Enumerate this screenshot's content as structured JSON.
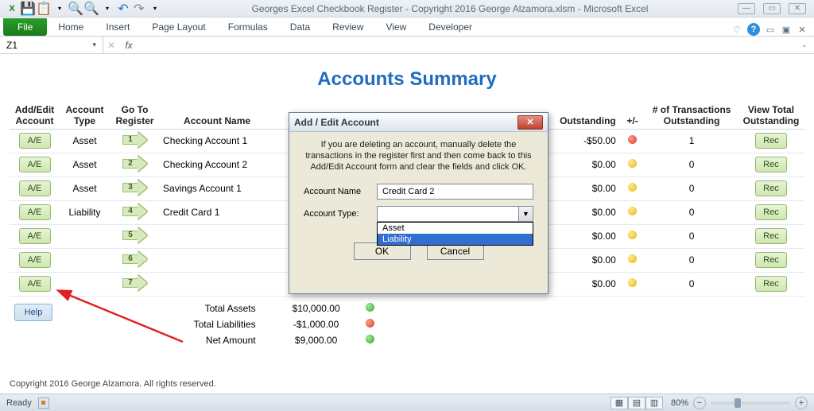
{
  "window": {
    "title": "Georges Excel Checkbook Register - Copyright 2016 George Alzamora.xlsm  -  Microsoft Excel"
  },
  "ribbon": {
    "file": "File",
    "tabs": [
      "Home",
      "Insert",
      "Page Layout",
      "Formulas",
      "Data",
      "Review",
      "View",
      "Developer"
    ]
  },
  "formulabar": {
    "name": "Z1",
    "fx": ""
  },
  "sheet": {
    "title": "Accounts Summary",
    "headers": {
      "ae": "Add/Edit Account",
      "type": "Account Type",
      "goto": "Go To Register",
      "name": "Account Name",
      "outstanding": "Outstanding",
      "plusminus": "+/-",
      "ntrans": "# of Transactions Outstanding",
      "viewtotal": "View Total Outstanding"
    },
    "ae_label": "A/E",
    "rec_label": "Rec",
    "help_label": "Help",
    "rows": [
      {
        "type": "Asset",
        "num": "1",
        "name": "Checking Account 1",
        "outstanding": "-$50.00",
        "dot": "red",
        "ntrans": "1"
      },
      {
        "type": "Asset",
        "num": "2",
        "name": "Checking Account 2",
        "outstanding": "$0.00",
        "dot": "yellow",
        "ntrans": "0"
      },
      {
        "type": "Asset",
        "num": "3",
        "name": "Savings Account 1",
        "outstanding": "$0.00",
        "dot": "yellow",
        "ntrans": "0"
      },
      {
        "type": "Liability",
        "num": "4",
        "name": "Credit Card 1",
        "outstanding": "$0.00",
        "dot": "yellow",
        "ntrans": "0"
      },
      {
        "type": "",
        "num": "5",
        "name": "",
        "outstanding": "$0.00",
        "dot": "yellow",
        "ntrans": "0"
      },
      {
        "type": "",
        "num": "6",
        "name": "",
        "outstanding": "$0.00",
        "dot": "yellow",
        "ntrans": "0"
      },
      {
        "type": "",
        "num": "7",
        "name": "",
        "outstanding": "$0.00",
        "dot": "yellow",
        "ntrans": "0"
      }
    ],
    "totals": [
      {
        "label": "Total Assets",
        "value": "$10,000.00",
        "dot": "green"
      },
      {
        "label": "Total Liabilities",
        "value": "-$1,000.00",
        "dot": "red"
      },
      {
        "label": "Net Amount",
        "value": "$9,000.00",
        "dot": "green"
      }
    ]
  },
  "dialog": {
    "title": "Add / Edit Account",
    "msg": "If you are deleting an account, manually delete the transactions in the register first and then come back to this Add/Edit Account form and clear the fields and click OK.",
    "name_label": "Account Name",
    "name_value": "Credit Card 2",
    "type_label": "Account Type:",
    "options": [
      "Asset",
      "Liability"
    ],
    "selected_index": 1,
    "ok": "OK",
    "cancel": "Cancel"
  },
  "copyright": "Copyright 2016  George Alzamora.  All rights reserved.",
  "status": {
    "ready": "Ready",
    "zoom": "80%"
  }
}
